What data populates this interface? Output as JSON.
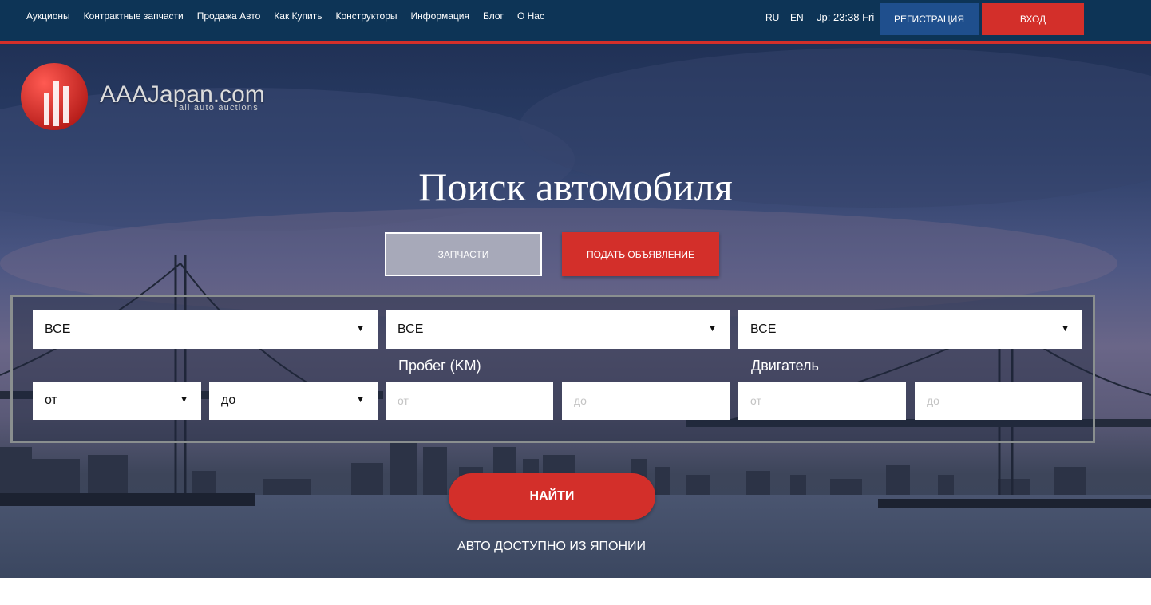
{
  "nav": {
    "items": [
      "Аукционы",
      "Контрактные запчасти",
      "Продажа Авто",
      "Как Купить",
      "Конструкторы",
      "Информация",
      "Блог",
      "О Нас"
    ],
    "lang_ru": "RU",
    "lang_en": "EN",
    "clock": "Jp: 23:38 Fri",
    "register": "РЕГИСТРАЦИЯ",
    "login": "ВХОД"
  },
  "logo": {
    "name": "AAAJapan.com",
    "tagline": "all auto auctions"
  },
  "hero": {
    "title": "Поиск автомобиля",
    "parts_button": "ЗАПЧАСТИ",
    "ad_button": "ПОДАТЬ ОБЪЯВЛЕНИЕ"
  },
  "search": {
    "maker_value": "ВСЕ",
    "model_value": "ВСЕ",
    "body_value": "ВСЕ",
    "year_from_value": "от",
    "year_to_value": "до",
    "mileage_label": "Пробег (KM)",
    "mileage_from_placeholder": "от",
    "mileage_to_placeholder": "до",
    "engine_label": "Двигатель",
    "engine_from_placeholder": "от",
    "engine_to_placeholder": "до",
    "submit": "НАЙТИ"
  },
  "footer_note": "АВТО ДОСТУПНО ИЗ ЯПОНИИ",
  "colors": {
    "topbar": "#0d3456",
    "accent_red": "#d32f2a",
    "register_blue": "#1f4f8d",
    "parts_gray": "#a7a9b9"
  }
}
